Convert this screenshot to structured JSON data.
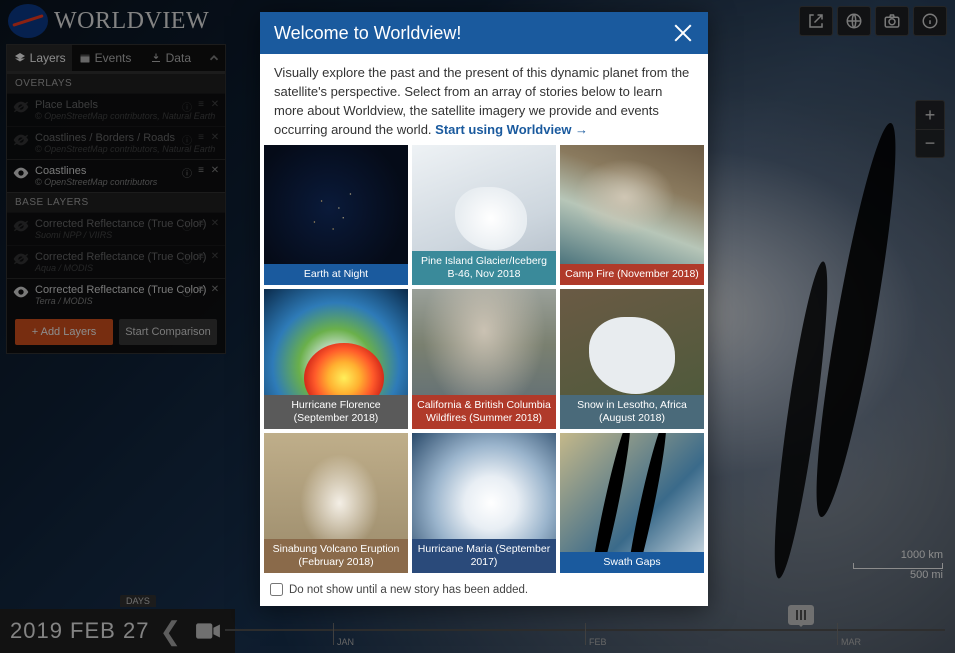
{
  "app": {
    "title": "WORLDVIEW",
    "brand": "NASA"
  },
  "tabs": {
    "layers": "Layers",
    "events": "Events",
    "data": "Data"
  },
  "sidebar": {
    "overlays_h": "OVERLAYS",
    "base_h": "BASE LAYERS",
    "overlays": [
      {
        "title": "Place Labels",
        "sub": "© OpenStreetMap contributors, Natural Earth",
        "visible": false
      },
      {
        "title": "Coastlines / Borders / Roads",
        "sub": "© OpenStreetMap contributors, Natural Earth",
        "visible": false
      },
      {
        "title": "Coastlines",
        "sub": "© OpenStreetMap contributors",
        "visible": true
      }
    ],
    "base": [
      {
        "title": "Corrected Reflectance (True Color)",
        "sub": "Suomi NPP / VIIRS",
        "visible": false
      },
      {
        "title": "Corrected Reflectance (True Color)",
        "sub": "Aqua / MODIS",
        "visible": false
      },
      {
        "title": "Corrected Reflectance (True Color)",
        "sub": "Terra / MODIS",
        "visible": true
      }
    ],
    "add": "+ Add Layers",
    "compare": "Start Comparison"
  },
  "modal": {
    "title": "Welcome to Worldview!",
    "body": "Visually explore the past and the present of this dynamic planet from the satellite's perspective. Select from an array of stories below to learn more about Worldview, the satellite imagery we provide and events occurring around the world. ",
    "link": "Start using Worldview →",
    "checkbox": "Do not show until a new story has been added.",
    "stories": [
      {
        "caption": "Earth at Night",
        "thumb": "t-night",
        "cap": "cap-blue"
      },
      {
        "caption": "Pine Island Glacier/Iceberg B-46, Nov 2018",
        "thumb": "t-ice",
        "cap": "cap-teal"
      },
      {
        "caption": "Camp Fire (November 2018)",
        "thumb": "t-fire",
        "cap": "cap-red"
      },
      {
        "caption": "Hurricane Florence (September 2018)",
        "thumb": "t-hurr",
        "cap": "cap-grey"
      },
      {
        "caption": "California & British Columbia Wildfires (Summer 2018)",
        "thumb": "t-wild",
        "cap": "cap-red"
      },
      {
        "caption": "Snow in Lesotho, Africa (August 2018)",
        "thumb": "t-snow",
        "cap": "cap-slate"
      },
      {
        "caption": "Sinabung Volcano Eruption (February 2018)",
        "thumb": "t-volc",
        "cap": "cap-brown"
      },
      {
        "caption": "Hurricane Maria (September 2017)",
        "thumb": "t-maria",
        "cap": "cap-dblue"
      },
      {
        "caption": "Swath Gaps",
        "thumb": "t-swath",
        "cap": "cap-blue"
      }
    ]
  },
  "timeline": {
    "date": "2019 FEB 27",
    "unit": "DAYS",
    "ticks": [
      {
        "label": "JAN",
        "pct": 15
      },
      {
        "label": "FEB",
        "pct": 50
      },
      {
        "label": "MAR",
        "pct": 85
      }
    ],
    "handle_pct": 80
  },
  "scale": {
    "top": "1000 km",
    "bottom": "500 mi"
  },
  "icons": {
    "layers": "layers",
    "events": "events",
    "data": "download",
    "share": "share",
    "globe": "globe",
    "camera": "camera",
    "info": "info"
  }
}
